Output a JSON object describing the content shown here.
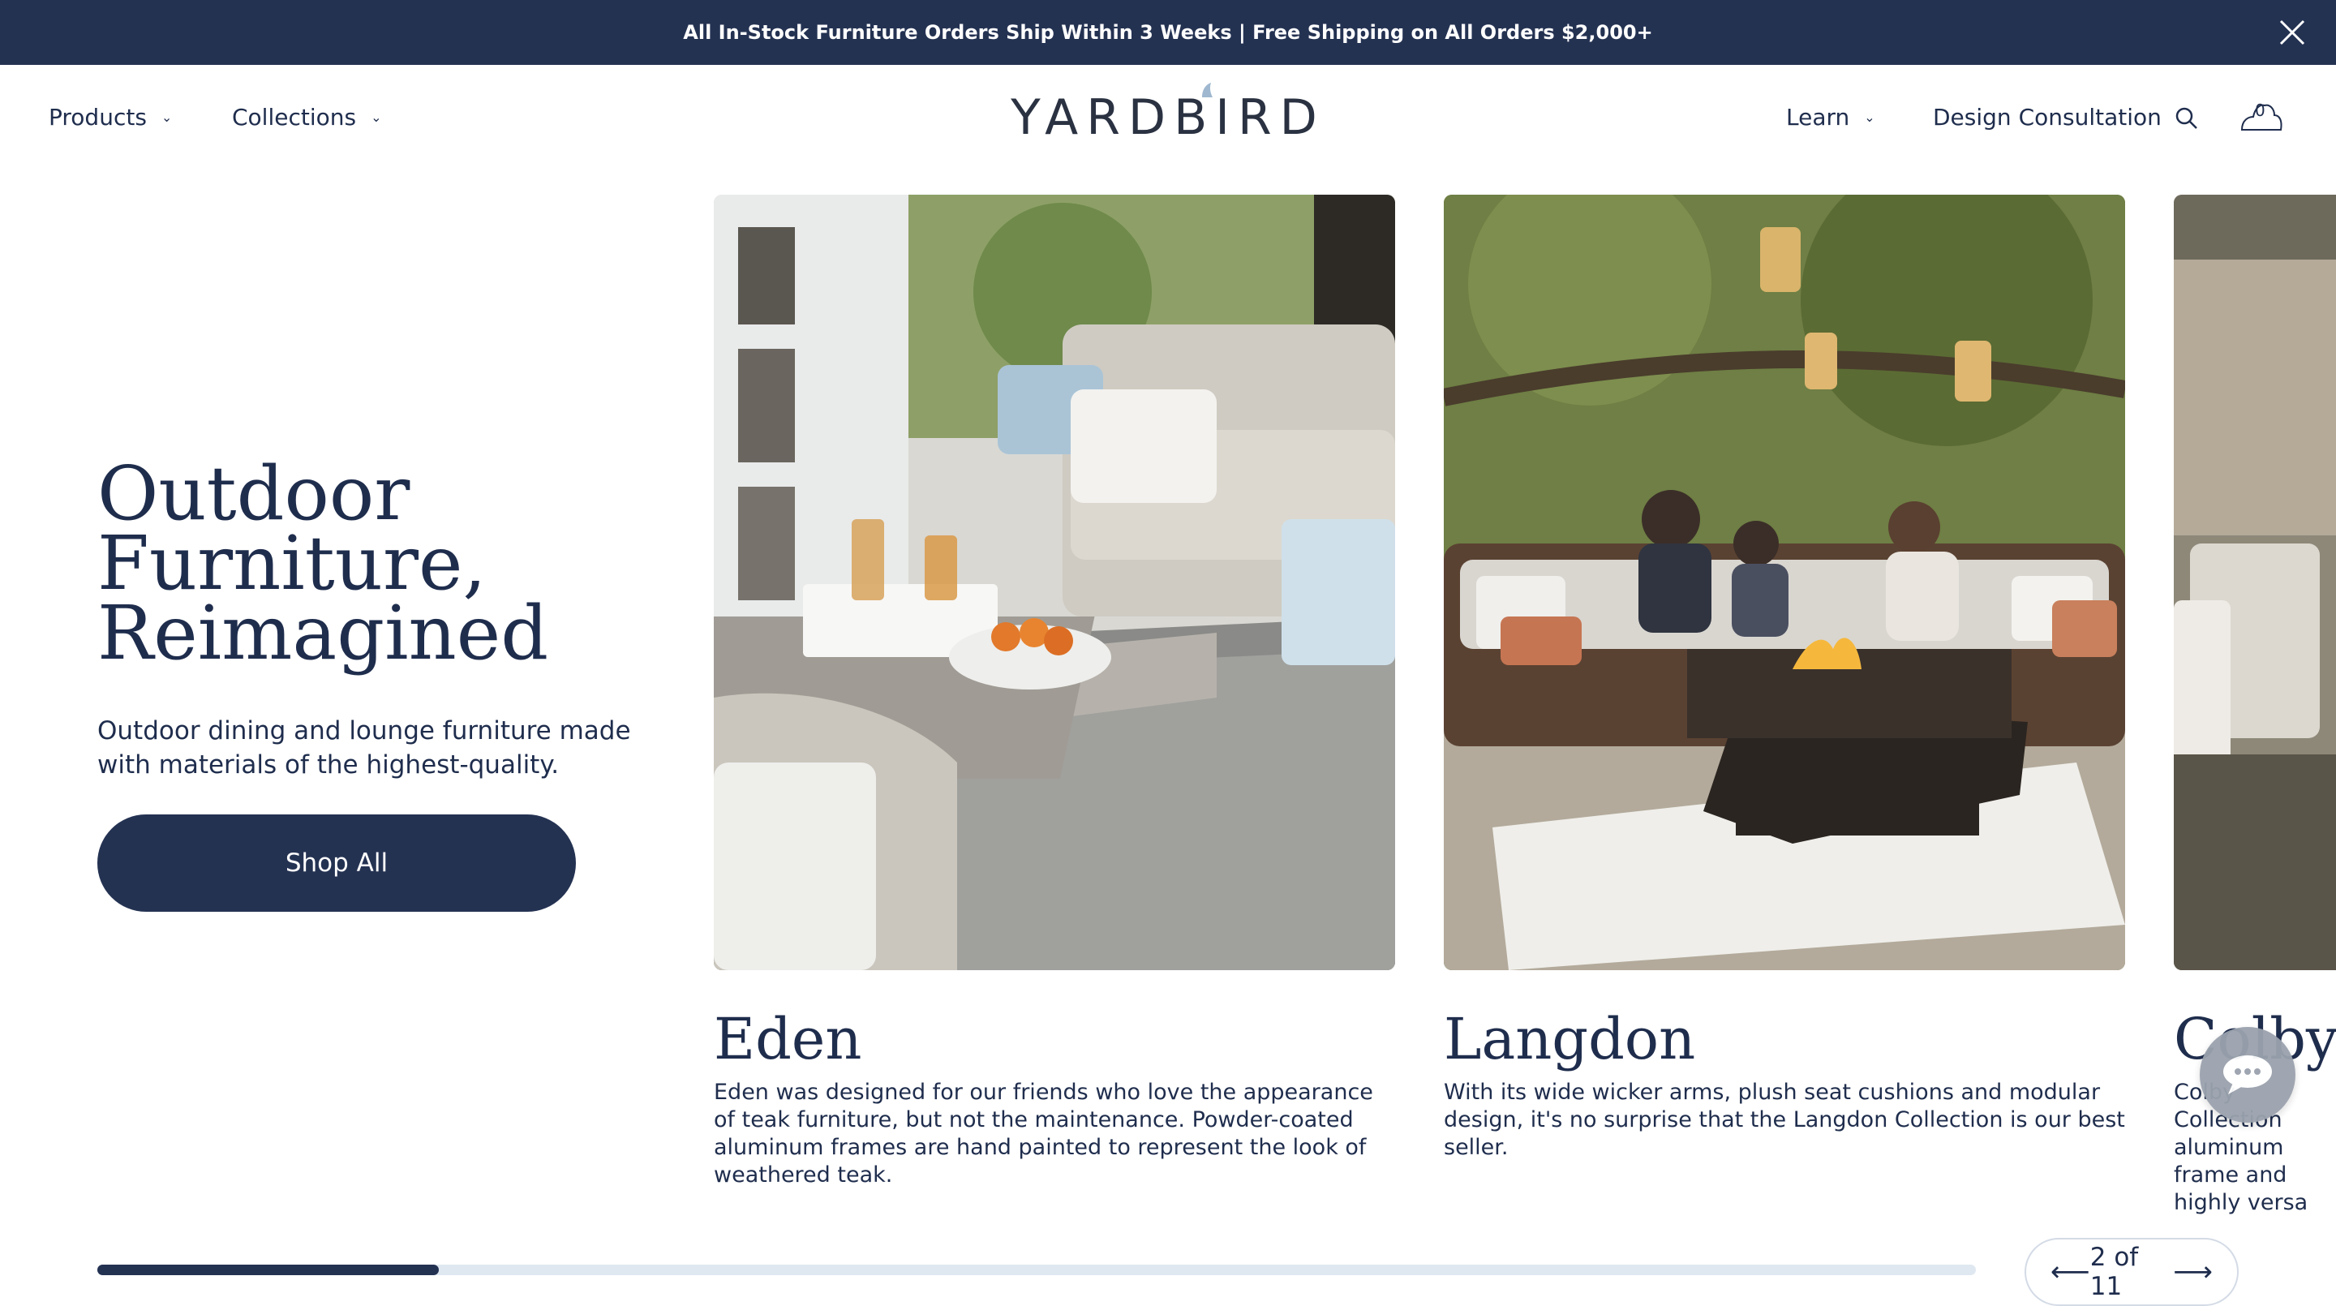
{
  "announcement": {
    "text": "All In-Stock Furniture Orders Ship Within 3 Weeks | Free Shipping on All Orders $2,000+"
  },
  "nav": {
    "left": [
      {
        "label": "Products"
      },
      {
        "label": "Collections"
      }
    ],
    "logo": "YARDBIRD",
    "right": [
      {
        "label": "Learn"
      },
      {
        "label": "Design Consultation"
      }
    ],
    "cart_count": "0"
  },
  "hero": {
    "title_lines": [
      "Outdoor",
      "Furniture,",
      "Reimagined"
    ],
    "subtitle": "Outdoor dining and lounge furniture made with materials of the highest-quality.",
    "cta": "Shop All"
  },
  "collections": [
    {
      "title": "Eden",
      "description": "Eden was designed for our friends who love the appearance of teak furniture, but not the maintenance. Powder-coated aluminum frames are hand painted to represent the look of weathered teak."
    },
    {
      "title": "Langdon",
      "description": "With its wide wicker arms, plush seat cushions and modular design, it's no surprise that the Langdon Collection is our best seller."
    },
    {
      "title": "Colby",
      "description": "Colby Collection aluminum frame and highly versa"
    }
  ],
  "carousel": {
    "pager_text": "2 of 11",
    "current": 2,
    "total": 11
  },
  "colors": {
    "navy": "#243252",
    "text": "#1f2d4d",
    "track": "#dfe8f1"
  }
}
